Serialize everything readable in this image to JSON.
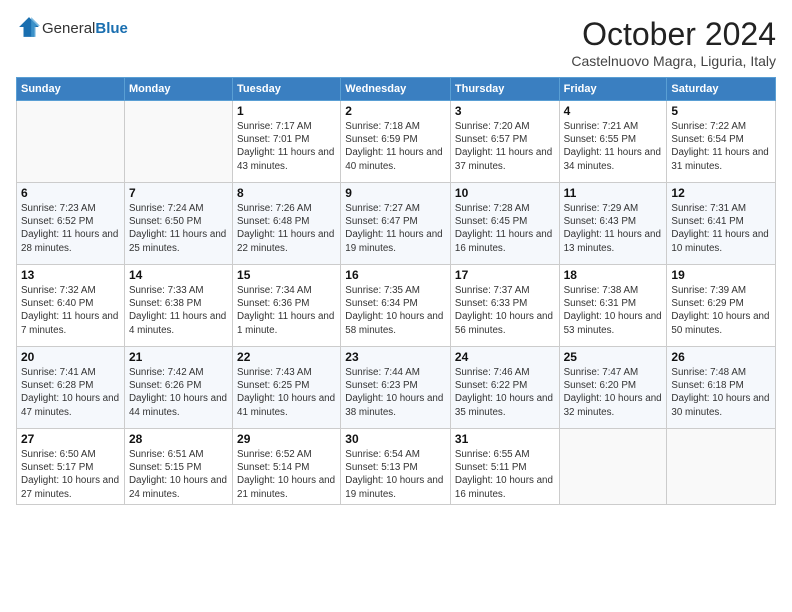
{
  "header": {
    "logo_general": "General",
    "logo_blue": "Blue",
    "month": "October 2024",
    "location": "Castelnuovo Magra, Liguria, Italy"
  },
  "weekdays": [
    "Sunday",
    "Monday",
    "Tuesday",
    "Wednesday",
    "Thursday",
    "Friday",
    "Saturday"
  ],
  "weeks": [
    [
      {
        "day": "",
        "info": ""
      },
      {
        "day": "",
        "info": ""
      },
      {
        "day": "1",
        "info": "Sunrise: 7:17 AM\nSunset: 7:01 PM\nDaylight: 11 hours and 43 minutes."
      },
      {
        "day": "2",
        "info": "Sunrise: 7:18 AM\nSunset: 6:59 PM\nDaylight: 11 hours and 40 minutes."
      },
      {
        "day": "3",
        "info": "Sunrise: 7:20 AM\nSunset: 6:57 PM\nDaylight: 11 hours and 37 minutes."
      },
      {
        "day": "4",
        "info": "Sunrise: 7:21 AM\nSunset: 6:55 PM\nDaylight: 11 hours and 34 minutes."
      },
      {
        "day": "5",
        "info": "Sunrise: 7:22 AM\nSunset: 6:54 PM\nDaylight: 11 hours and 31 minutes."
      }
    ],
    [
      {
        "day": "6",
        "info": "Sunrise: 7:23 AM\nSunset: 6:52 PM\nDaylight: 11 hours and 28 minutes."
      },
      {
        "day": "7",
        "info": "Sunrise: 7:24 AM\nSunset: 6:50 PM\nDaylight: 11 hours and 25 minutes."
      },
      {
        "day": "8",
        "info": "Sunrise: 7:26 AM\nSunset: 6:48 PM\nDaylight: 11 hours and 22 minutes."
      },
      {
        "day": "9",
        "info": "Sunrise: 7:27 AM\nSunset: 6:47 PM\nDaylight: 11 hours and 19 minutes."
      },
      {
        "day": "10",
        "info": "Sunrise: 7:28 AM\nSunset: 6:45 PM\nDaylight: 11 hours and 16 minutes."
      },
      {
        "day": "11",
        "info": "Sunrise: 7:29 AM\nSunset: 6:43 PM\nDaylight: 11 hours and 13 minutes."
      },
      {
        "day": "12",
        "info": "Sunrise: 7:31 AM\nSunset: 6:41 PM\nDaylight: 11 hours and 10 minutes."
      }
    ],
    [
      {
        "day": "13",
        "info": "Sunrise: 7:32 AM\nSunset: 6:40 PM\nDaylight: 11 hours and 7 minutes."
      },
      {
        "day": "14",
        "info": "Sunrise: 7:33 AM\nSunset: 6:38 PM\nDaylight: 11 hours and 4 minutes."
      },
      {
        "day": "15",
        "info": "Sunrise: 7:34 AM\nSunset: 6:36 PM\nDaylight: 11 hours and 1 minute."
      },
      {
        "day": "16",
        "info": "Sunrise: 7:35 AM\nSunset: 6:34 PM\nDaylight: 10 hours and 58 minutes."
      },
      {
        "day": "17",
        "info": "Sunrise: 7:37 AM\nSunset: 6:33 PM\nDaylight: 10 hours and 56 minutes."
      },
      {
        "day": "18",
        "info": "Sunrise: 7:38 AM\nSunset: 6:31 PM\nDaylight: 10 hours and 53 minutes."
      },
      {
        "day": "19",
        "info": "Sunrise: 7:39 AM\nSunset: 6:29 PM\nDaylight: 10 hours and 50 minutes."
      }
    ],
    [
      {
        "day": "20",
        "info": "Sunrise: 7:41 AM\nSunset: 6:28 PM\nDaylight: 10 hours and 47 minutes."
      },
      {
        "day": "21",
        "info": "Sunrise: 7:42 AM\nSunset: 6:26 PM\nDaylight: 10 hours and 44 minutes."
      },
      {
        "day": "22",
        "info": "Sunrise: 7:43 AM\nSunset: 6:25 PM\nDaylight: 10 hours and 41 minutes."
      },
      {
        "day": "23",
        "info": "Sunrise: 7:44 AM\nSunset: 6:23 PM\nDaylight: 10 hours and 38 minutes."
      },
      {
        "day": "24",
        "info": "Sunrise: 7:46 AM\nSunset: 6:22 PM\nDaylight: 10 hours and 35 minutes."
      },
      {
        "day": "25",
        "info": "Sunrise: 7:47 AM\nSunset: 6:20 PM\nDaylight: 10 hours and 32 minutes."
      },
      {
        "day": "26",
        "info": "Sunrise: 7:48 AM\nSunset: 6:18 PM\nDaylight: 10 hours and 30 minutes."
      }
    ],
    [
      {
        "day": "27",
        "info": "Sunrise: 6:50 AM\nSunset: 5:17 PM\nDaylight: 10 hours and 27 minutes."
      },
      {
        "day": "28",
        "info": "Sunrise: 6:51 AM\nSunset: 5:15 PM\nDaylight: 10 hours and 24 minutes."
      },
      {
        "day": "29",
        "info": "Sunrise: 6:52 AM\nSunset: 5:14 PM\nDaylight: 10 hours and 21 minutes."
      },
      {
        "day": "30",
        "info": "Sunrise: 6:54 AM\nSunset: 5:13 PM\nDaylight: 10 hours and 19 minutes."
      },
      {
        "day": "31",
        "info": "Sunrise: 6:55 AM\nSunset: 5:11 PM\nDaylight: 10 hours and 16 minutes."
      },
      {
        "day": "",
        "info": ""
      },
      {
        "day": "",
        "info": ""
      }
    ]
  ]
}
